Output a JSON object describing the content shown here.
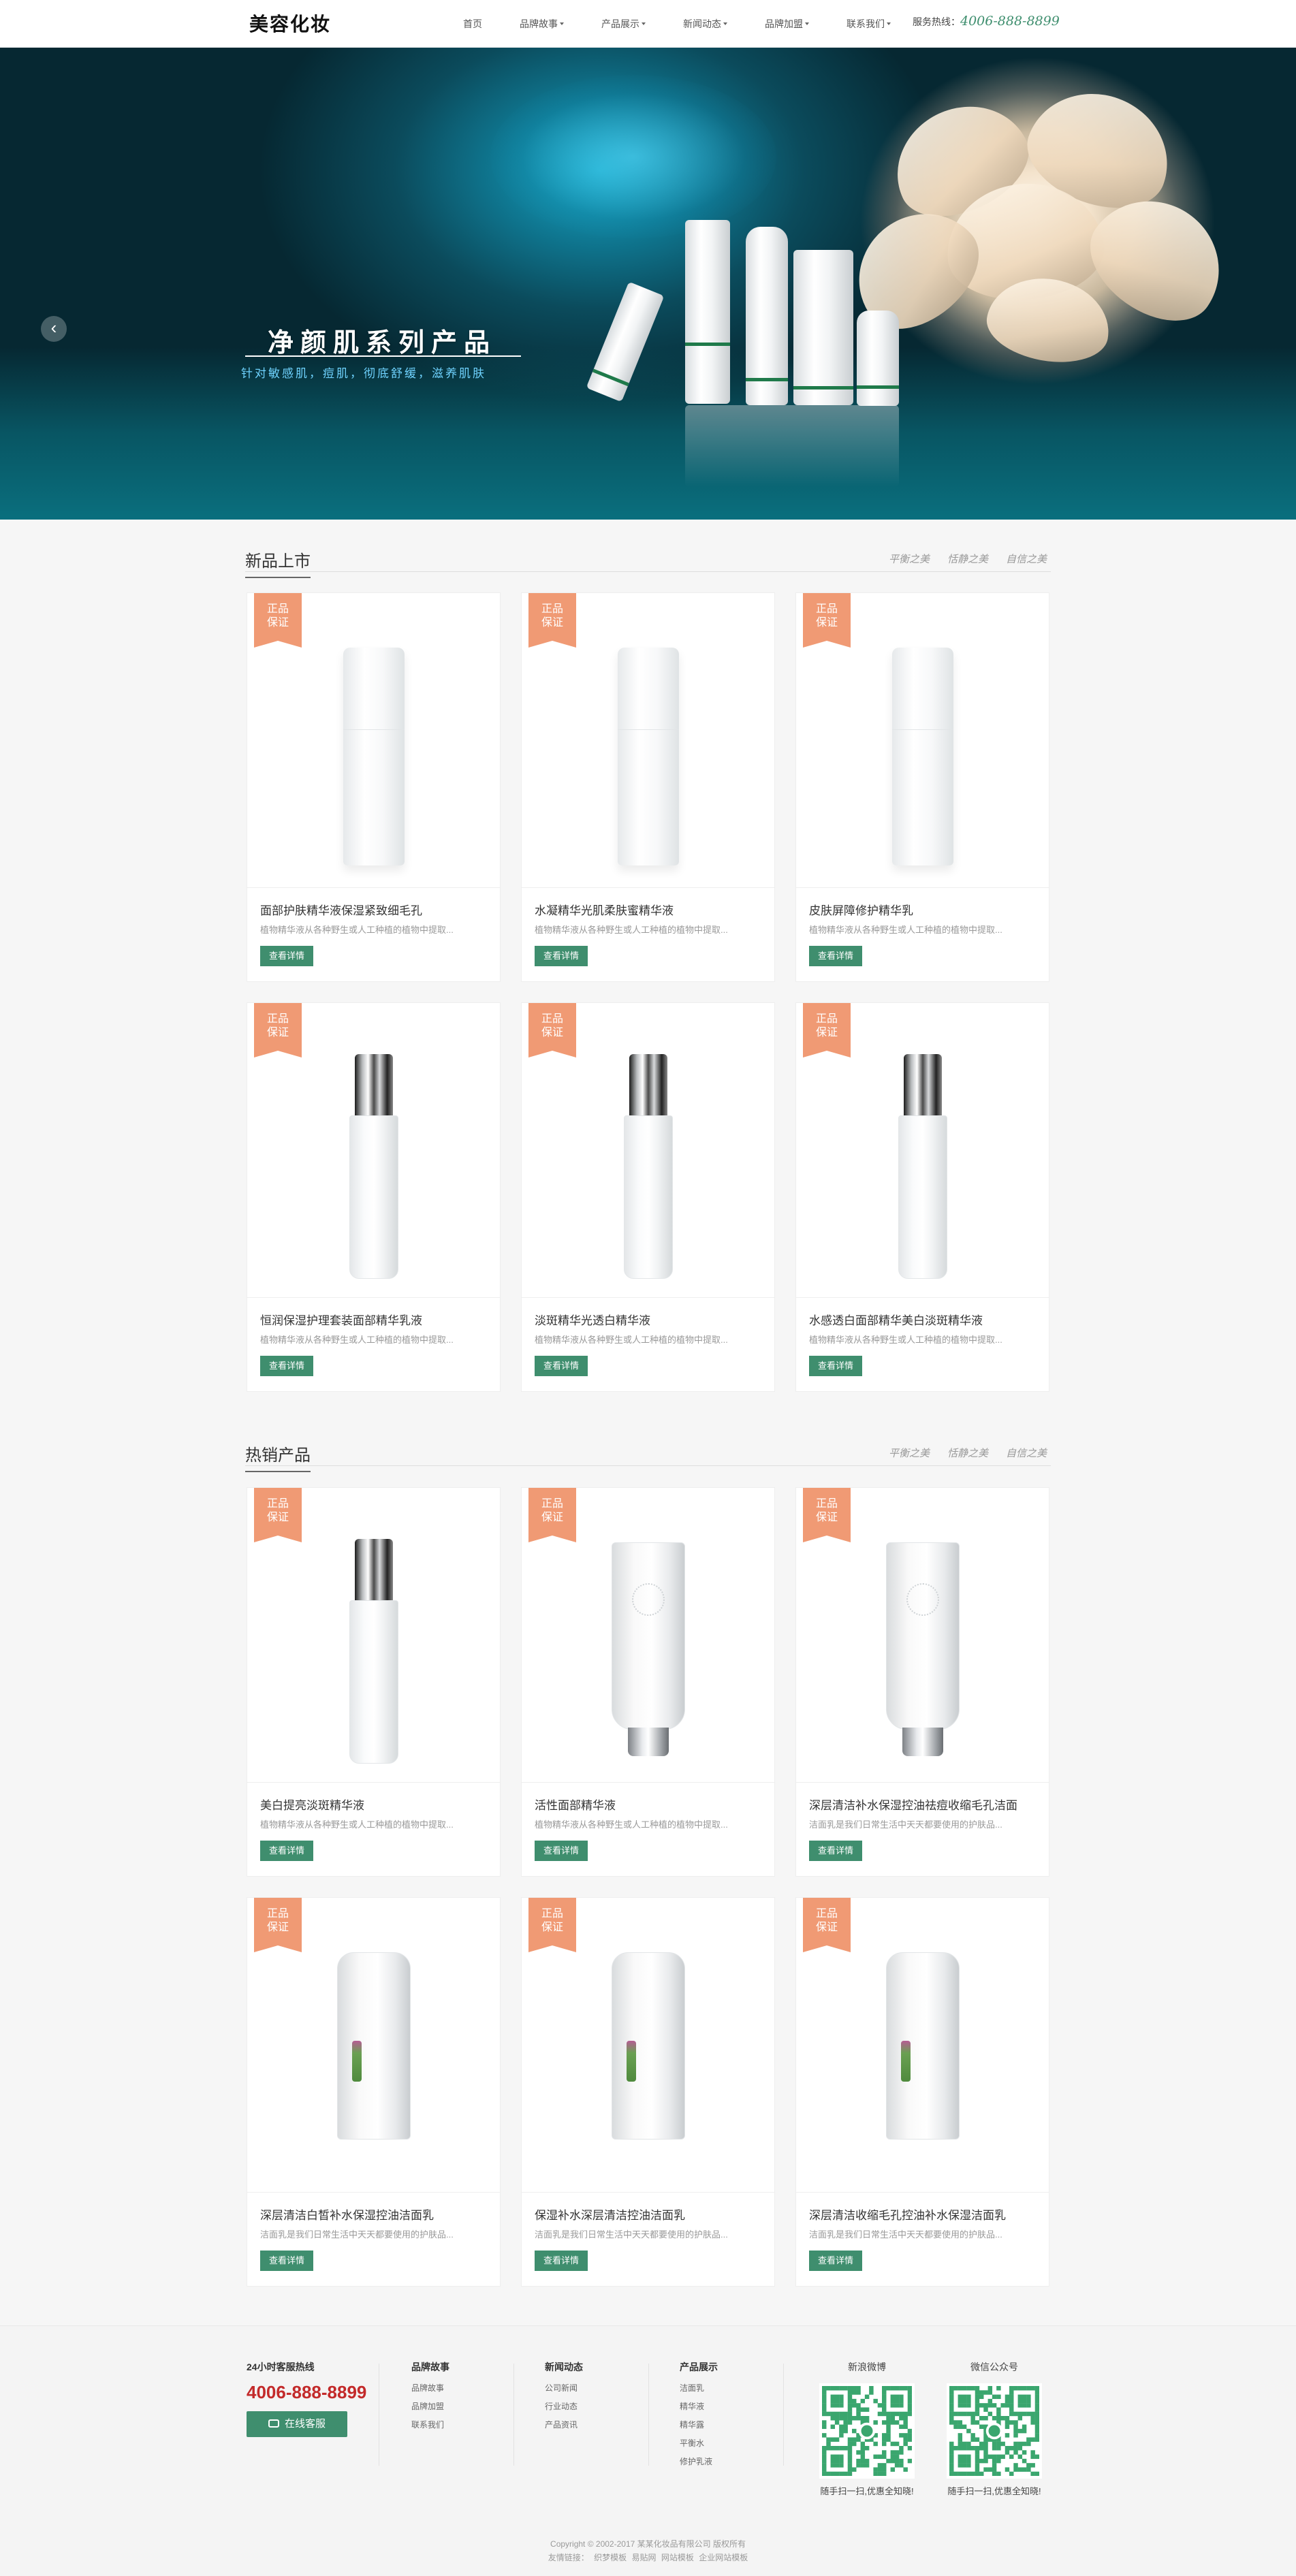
{
  "header": {
    "logo": "美容化妆",
    "nav": [
      {
        "label": "首页",
        "caret": false
      },
      {
        "label": "品牌故事",
        "caret": true
      },
      {
        "label": "产品展示",
        "caret": true
      },
      {
        "label": "新闻动态",
        "caret": true
      },
      {
        "label": "品牌加盟",
        "caret": true
      },
      {
        "label": "联系我们",
        "caret": true
      }
    ],
    "hotline_label": "服务热线：",
    "hotline_number": "4006-888-8899"
  },
  "banner": {
    "title": "净颜肌系列产品",
    "subtitle": "针对敏感肌，痘肌，彻底舒缓，滋养肌肤",
    "prev_icon": "chevron-left-icon",
    "slides": 3,
    "active_slide": 2
  },
  "sections": {
    "new": {
      "title": "新品上市",
      "tags": [
        "平衡之美",
        "恬静之美",
        "自信之美"
      ]
    },
    "hot": {
      "title": "热销产品",
      "tags": [
        "平衡之美",
        "恬静之美",
        "自信之美"
      ]
    }
  },
  "badge": "正品保证",
  "badge_lines": [
    "正品",
    "保证"
  ],
  "button_label": "查看详情",
  "products_new": [
    {
      "title": "面部护肤精华液保湿紧致细毛孔",
      "desc": "植物精华液从各种野生或人工种植的植物中提取...",
      "art": "tall"
    },
    {
      "title": "水凝精华光肌柔肤蜜精华液",
      "desc": "植物精华液从各种野生或人工种植的植物中提取...",
      "art": "tall"
    },
    {
      "title": "皮肤屏障修护精华乳",
      "desc": "植物精华液从各种野生或人工种植的植物中提取...",
      "art": "tall"
    },
    {
      "title": "恒润保湿护理套装面部精华乳液",
      "desc": "植物精华液从各种野生或人工种植的植物中提取...",
      "art": "pump"
    },
    {
      "title": "淡斑精华光透白精华液",
      "desc": "植物精华液从各种野生或人工种植的植物中提取...",
      "art": "pump"
    },
    {
      "title": "水感透白面部精华美白淡斑精华液",
      "desc": "植物精华液从各种野生或人工种植的植物中提取...",
      "art": "pump"
    }
  ],
  "products_hot": [
    {
      "title": "美白提亮淡斑精华液",
      "desc": "植物精华液从各种野生或人工种植的植物中提取...",
      "art": "pump"
    },
    {
      "title": "活性面部精华液",
      "desc": "植物精华液从各种野生或人工种植的植物中提取...",
      "art": "tube"
    },
    {
      "title": "深层清洁补水保湿控油祛痘收缩毛孔洁面",
      "desc": "洁面乳是我们日常生活中天天都要使用的护肤品...",
      "art": "tube"
    },
    {
      "title": "深层清洁白皙补水保湿控油洁面乳",
      "desc": "洁面乳是我们日常生活中天天都要使用的护肤品...",
      "art": "green"
    },
    {
      "title": "保湿补水深层清洁控油洁面乳",
      "desc": "洁面乳是我们日常生活中天天都要使用的护肤品...",
      "art": "green"
    },
    {
      "title": "深层清洁收缩毛孔控油补水保湿洁面乳",
      "desc": "洁面乳是我们日常生活中天天都要使用的护肤品...",
      "art": "green"
    }
  ],
  "footer": {
    "hotline_label": "24小时客服热线",
    "hotline_number": "4006-888-8899",
    "service_button": "在线客服",
    "columns": [
      {
        "title": "品牌故事",
        "links": [
          "品牌故事",
          "品牌加盟",
          "联系我们"
        ]
      },
      {
        "title": "新闻动态",
        "links": [
          "公司新闻",
          "行业动态",
          "产品资讯"
        ]
      },
      {
        "title": "产品展示",
        "links": [
          "洁面乳",
          "精华液",
          "精华露",
          "平衡水",
          "修护乳液"
        ]
      }
    ],
    "qr": [
      {
        "title": "新浪微博",
        "caption": "随手扫一扫,优惠全知晓!"
      },
      {
        "title": "微信公众号",
        "caption": "随手扫一扫,优惠全知晓!"
      }
    ],
    "copyright": "Copyright © 2002-2017 某某化妆品有限公司 版权所有",
    "friend_links_label": "友情链接：",
    "friend_links": [
      "织梦模板",
      "易贴网",
      "网站模板",
      "企业网站模板"
    ]
  },
  "colors": {
    "accent": "#3f8e6e",
    "badge": "#f09a74",
    "phone": "#c32a2a",
    "banner_dark": "#062832"
  }
}
